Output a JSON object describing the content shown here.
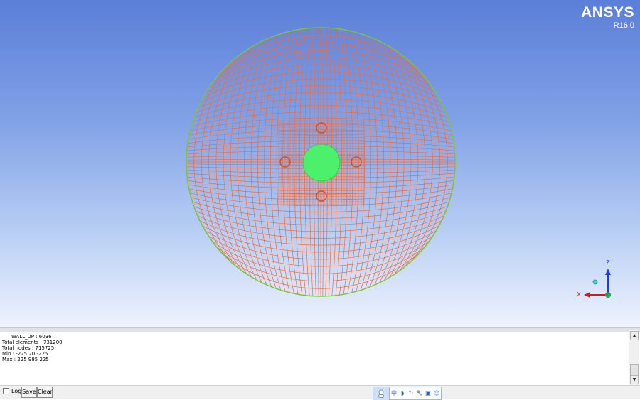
{
  "app": {
    "brand_name": "ANSYS",
    "brand_version": "R16.0"
  },
  "colors": {
    "mesh_line": "#f26a3c",
    "mesh_outline": "#7ec33b",
    "wall_fill": "#4cf06b",
    "axis_z": "#1a3fd8",
    "axis_x": "#d21919",
    "axis_origin": "#1ea44a",
    "bg_top": "#5b7fd8",
    "bg_bottom": "#eef3fd"
  },
  "axis_triad": {
    "z_label": "Z",
    "x_label": "X"
  },
  "console": {
    "lines": [
      "WALL_UP : 6036",
      "Total elements : 731200",
      "Total nodes : 715725",
      "Min : -225 20 -225",
      "Max : 225 985 225"
    ]
  },
  "bottom_bar": {
    "log_label": "Log",
    "save_label": "Save",
    "clear_label": "Clear"
  },
  "ime_toolbar": {
    "items": [
      {
        "icon": "chinese-mode-icon",
        "glyph": "中"
      },
      {
        "icon": "moon-icon",
        "glyph": "◗"
      },
      {
        "icon": "punctuation-icon",
        "glyph": "°·"
      },
      {
        "icon": "wrench-icon",
        "glyph": "🔧"
      },
      {
        "icon": "clipboard-icon",
        "glyph": "▣"
      },
      {
        "icon": "smiley-icon",
        "glyph": "☺"
      }
    ]
  }
}
